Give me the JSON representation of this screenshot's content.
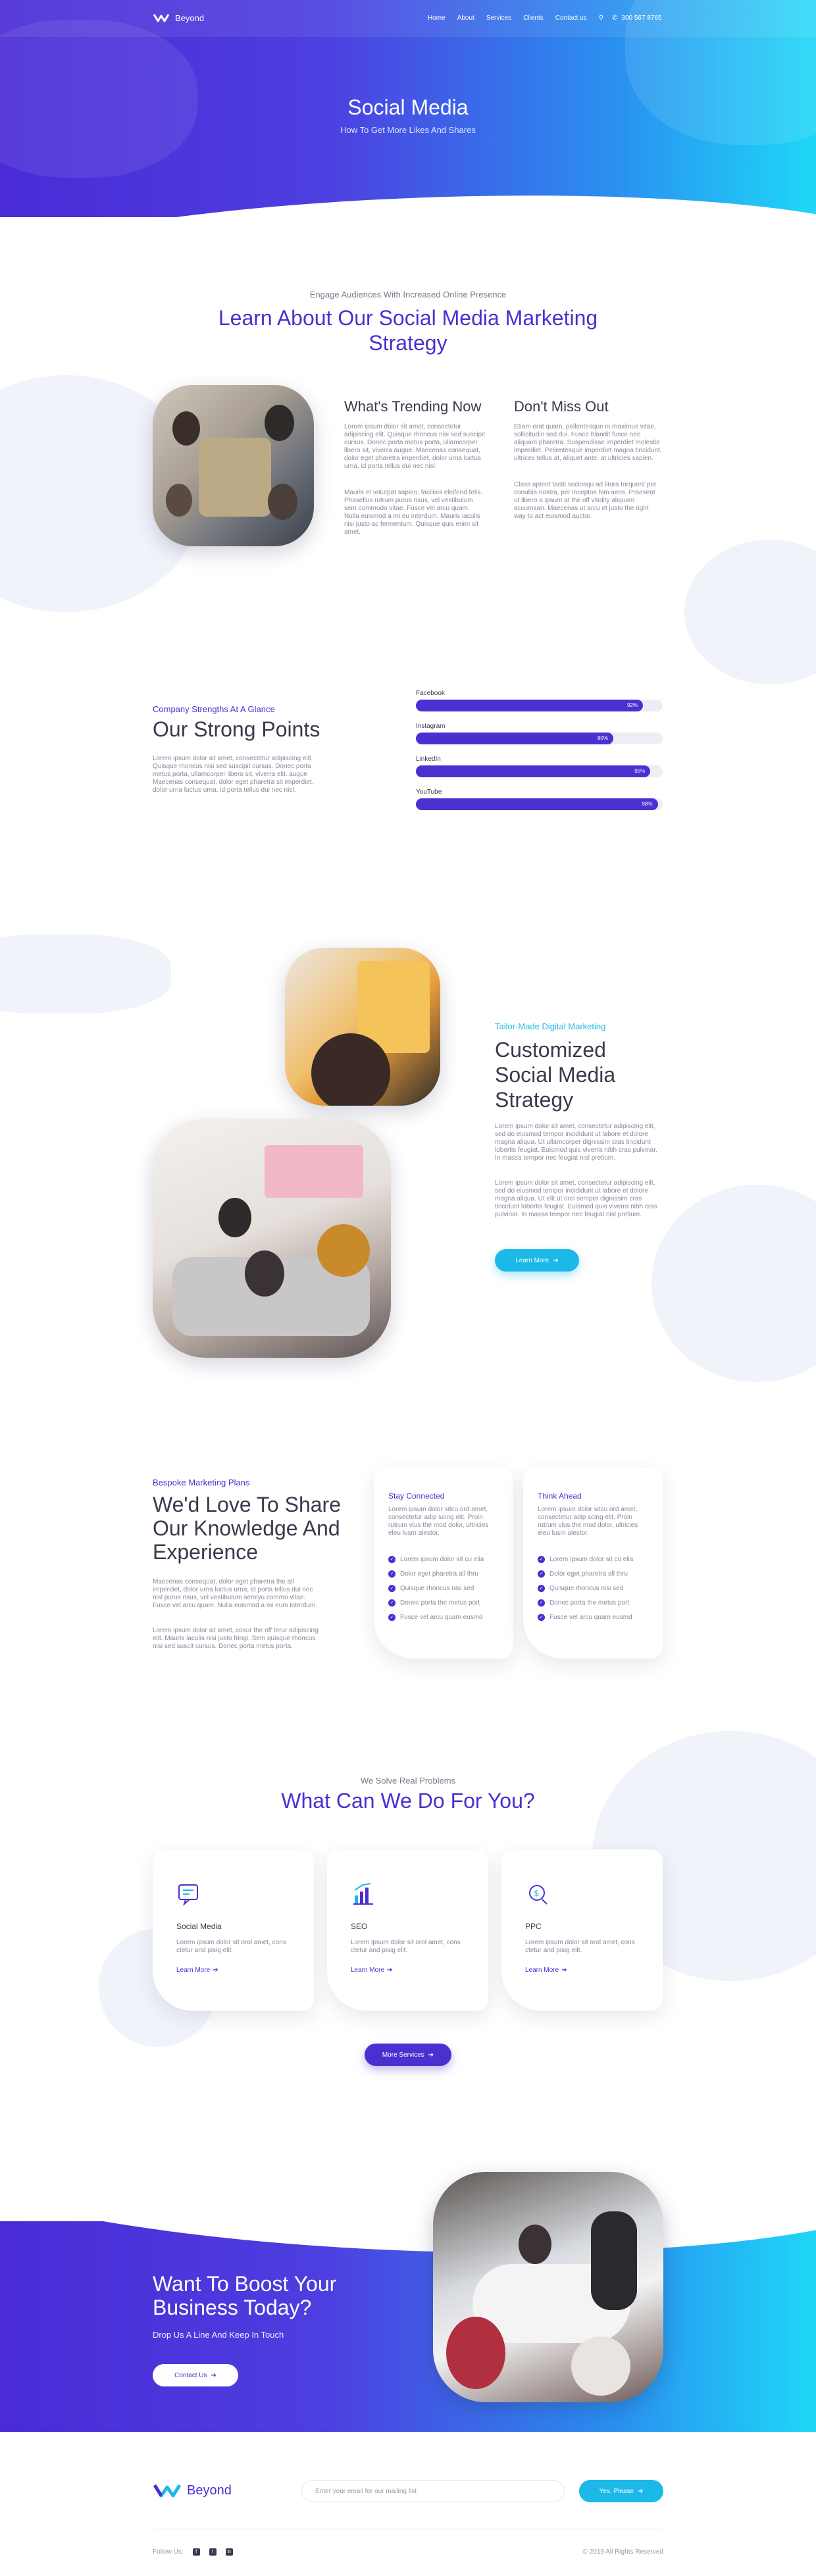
{
  "nav": {
    "brand": "Beyond",
    "links": [
      "Home",
      "About",
      "Services",
      "Clients",
      "Contact us"
    ],
    "phone": "300 567 8765"
  },
  "hero": {
    "title": "Social Media",
    "subtitle": "How To Get More Likes And Shares"
  },
  "strategy": {
    "kicker": "Engage Audiences With Increased Online Presence",
    "title": "Learn About Our Social Media Marketing Strategy",
    "col1": {
      "title": "What's Trending Now",
      "p1": "Lorem ipsum dolor sit amet, consectetur adipiscing elit. Quisque rhoncus nisi sed suscipit cursus. Donec porta metus porta, ullamcorper libero sit, viverra augue. Maecenas consequat, dolor eget pharetra imperdiet, dolor urna luctus urna, id porta tellus dui nec nisl.",
      "p2": "Mauris et volutpat sapien, facilisis eleifend felis. Phasellus rutrum purus risus, vel vestibulum sem commodo vitae. Fusce vel arcu quam. Nulla euismod a mi eu interdum. Mauris iaculis nisi justo ac fermentum. Quisque quis enim sit amet."
    },
    "col2": {
      "title": "Don't Miss Out",
      "p1": "Etiam erat quam, pellentesque in maximus vitae, sollicitudin sed dui. Fusce blandit fusce nec aliquam pharetra. Suspendisse imperdiet molestie imperdiet. Pellentesque imperdiet magna tincidunt, ultrices tellus at, aliquet ante, at ultricies sapien.",
      "p2": "Class aptent taciti sociosqu ad litora torquent per conubia nostra, per inceptos him aeos. Praesent ut libero a ipsum at the off vitolity aliquam accumsan. Maecenas ut arcu et justo the right way to act euismod auctor."
    }
  },
  "strengths": {
    "kicker": "Company Strengths At A Glance",
    "title": "Our Strong Points",
    "text": "Lorem ipsum dolor sit amet, consectetur adipiscing elit. Quisque rhoncus nisi sed suscipit cursus. Donec porta metus porta, ullamcorper libero sit, viverra elit. augue Maecenas consequat, dolor eget pharetra sit imperdiet, dolor urna luctus urna, id porta tellus dui nec nisl.",
    "bars": [
      {
        "label": "Facebook",
        "value": 92,
        "text": "92%"
      },
      {
        "label": "Instagram",
        "value": 80,
        "text": "80%"
      },
      {
        "label": "LinkedIn",
        "value": 95,
        "text": "95%"
      },
      {
        "label": "YouTube",
        "value": 98,
        "text": "98%"
      }
    ]
  },
  "custom": {
    "kicker": "Tailor-Made Digital Marketing",
    "title": "Customized Social Media Strategy",
    "p1": "Lorem ipsum dolor sit amet, consectetur adipiscing elit, sed do eiusmod tempor incididunt ut labore et dolore magna aliqua. Ut ullamcorper dignissim cras tincidunt lobortis feugiat. Euismod quis viverra nibh cras pulvinar. In massa tempor nec feugiat nisl pretium.",
    "p2": "Lorem ipsum dolor sit amet, consectetur adipiscing elit, sed do eiusmod tempor incididunt ut labore et dolore magna aliqua. Ut elit ut orci semper dignissim cras tincidunt lobortis feugiat. Euismod quis viverra nibh cras pulvinar. In massa tempor nec feugiat nisl pretium.",
    "button": "Learn More"
  },
  "knowledge": {
    "kicker": "Bespoke Marketing Plans",
    "title": "We'd Love To Share Our Knowledge And Experience",
    "p1": "Maecenas consequat, dolor eget pharetra the all imperdiet, dolor urna luctus urna, id porta tellus dui nec nisl purus risus, vel vestibulum semlyu commo vitae. Fusce vel arcu quam. Nulla euismod a mi eum interdum.",
    "p2": "Lorem ipsum dolor sit amet, cosur the off terur adipiscing elit. Mauris iaculis nisi justo fringi. Sem quisque rhoncus nisi sed suscit cursus. Donec porta metus porta.",
    "cards": [
      {
        "title": "Stay Connected",
        "text": "Lorem ipsum dolor sitcu ord amet, consectetur adip scing elit. Proin rutrum vlus the mod dolor, ultricies eleu lusm alestor.",
        "items": [
          "Lorem ipsum dolor sit cu elia",
          "Dolor eget pharetra all thru",
          "Quisque rhoncus nisi sed",
          "Donec porta the metus port",
          "Fusce vel arcu quam eusmd"
        ]
      },
      {
        "title": "Think Ahead",
        "text": "Lorem ipsum dolor sitcu ord amet, consectetur adip scing elit. Proin rutrum vlus the mod dolor, ultricies eleu lusm alestor.",
        "items": [
          "Lorem ipsum dolor sit cu elia",
          "Dolor eget pharetra all thru",
          "Quisque rhoncus nisi sed",
          "Donec porta the metus port",
          "Fusce vel arcu quam eusmd"
        ]
      }
    ]
  },
  "services": {
    "kicker": "We Solve Real Problems",
    "title": "What Can We Do For You?",
    "items": [
      {
        "icon": "social-media-icon",
        "title": "Social Media",
        "text": "Lorem ipsum dolor sit orol amet, cons ctetur and pisig elit.",
        "link": "Learn More"
      },
      {
        "icon": "seo-chart-icon",
        "title": "SEO",
        "text": "Lorem ipsum dolor sit orol amet, cons ctetur and pisig elit.",
        "link": "Learn More"
      },
      {
        "icon": "ppc-dollar-icon",
        "title": "PPC",
        "text": "Lorem ipsum dolor sit orol amet, cons ctetur and pisig elit.",
        "link": "Learn More"
      }
    ],
    "button": "More Services"
  },
  "cta": {
    "title": "Want To Boost Your Business Today?",
    "subtitle": "Drop Us A Line And Keep In Touch",
    "button": "Contact Us"
  },
  "footer": {
    "brand": "Beyond",
    "email_placeholder": "Enter your email for our mailing list",
    "subscribe": "Yes, Please",
    "follow": "Follow Us:",
    "copyright": "© 2019 All Rights Reserved"
  },
  "colors": {
    "purple": "#4b2fd0",
    "cyan": "#1bb8e8",
    "gradient_end": "#1ed7f7"
  }
}
